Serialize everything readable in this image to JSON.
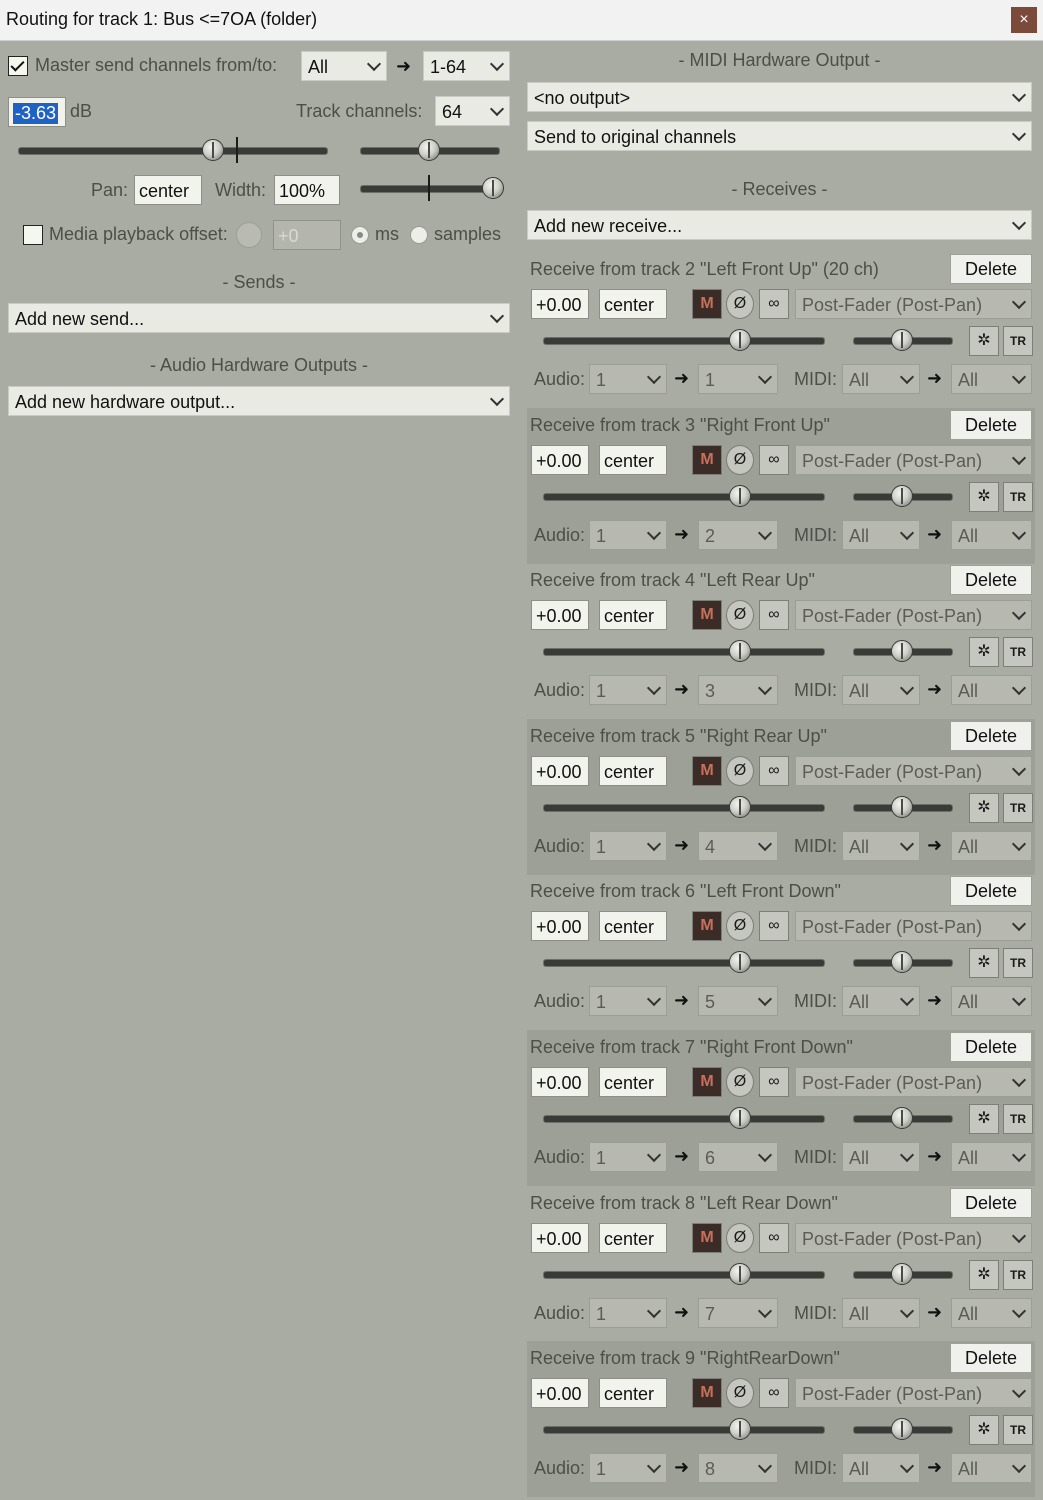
{
  "window": {
    "title": "Routing for track 1: Bus  <=7OA  (folder)",
    "close": "×"
  },
  "master": {
    "send_label": "Master send channels from/to:",
    "from": "All",
    "to": "1-64",
    "volume": "-3.63",
    "db": "dB",
    "track_channels_label": "Track channels:",
    "track_channels": "64",
    "pan_label": "Pan:",
    "pan": "center",
    "width_label": "Width:",
    "width": "100%",
    "offset_label": "Media playback offset:",
    "offset_value": "+0",
    "ms": "ms",
    "samples": "samples"
  },
  "sends": {
    "header": "- Sends -",
    "add": "Add new send..."
  },
  "audio_hw": {
    "header": "- Audio Hardware Outputs -",
    "add": "Add new hardware output..."
  },
  "midi_hw": {
    "header": "- MIDI Hardware Output -",
    "output": "<no output>",
    "channels": "Send to original channels"
  },
  "receives": {
    "header": "- Receives -",
    "add": "Add new receive...",
    "delete_label": "Delete",
    "audio_label": "Audio:",
    "midi_label": "MIDI:",
    "items": [
      {
        "title": "Receive from track 2 \"Left Front Up\" (20 ch)",
        "vol": "+0.00",
        "pan": "center",
        "mode": "Post-Fader (Post-Pan)",
        "audio_src": "1",
        "audio_dst": "1",
        "midi_src": "All",
        "midi_dst": "All"
      },
      {
        "title": "Receive from track 3 \"Right Front Up\"",
        "vol": "+0.00",
        "pan": "center",
        "mode": "Post-Fader (Post-Pan)",
        "audio_src": "1",
        "audio_dst": "2",
        "midi_src": "All",
        "midi_dst": "All"
      },
      {
        "title": "Receive from track 4 \"Left Rear Up\"",
        "vol": "+0.00",
        "pan": "center",
        "mode": "Post-Fader (Post-Pan)",
        "audio_src": "1",
        "audio_dst": "3",
        "midi_src": "All",
        "midi_dst": "All"
      },
      {
        "title": "Receive from track 5 \"Right Rear Up\"",
        "vol": "+0.00",
        "pan": "center",
        "mode": "Post-Fader (Post-Pan)",
        "audio_src": "1",
        "audio_dst": "4",
        "midi_src": "All",
        "midi_dst": "All"
      },
      {
        "title": "Receive from track 6 \"Left Front Down\"",
        "vol": "+0.00",
        "pan": "center",
        "mode": "Post-Fader (Post-Pan)",
        "audio_src": "1",
        "audio_dst": "5",
        "midi_src": "All",
        "midi_dst": "All"
      },
      {
        "title": "Receive from track 7 \"Right Front Down\"",
        "vol": "+0.00",
        "pan": "center",
        "mode": "Post-Fader (Post-Pan)",
        "audio_src": "1",
        "audio_dst": "6",
        "midi_src": "All",
        "midi_dst": "All"
      },
      {
        "title": "Receive from track 8 \"Left Rear Down\"",
        "vol": "+0.00",
        "pan": "center",
        "mode": "Post-Fader (Post-Pan)",
        "audio_src": "1",
        "audio_dst": "7",
        "midi_src": "All",
        "midi_dst": "All"
      },
      {
        "title": "Receive from track 9 \"RightRearDown\"",
        "vol": "+0.00",
        "pan": "center",
        "mode": "Post-Fader (Post-Pan)",
        "audio_src": "1",
        "audio_dst": "8",
        "midi_src": "All",
        "midi_dst": "All"
      }
    ]
  },
  "icons": {
    "mono": "M",
    "phase": "Ø",
    "stereo": "∞",
    "envelope": "✲",
    "trim": "TR",
    "arrow": "➜"
  }
}
